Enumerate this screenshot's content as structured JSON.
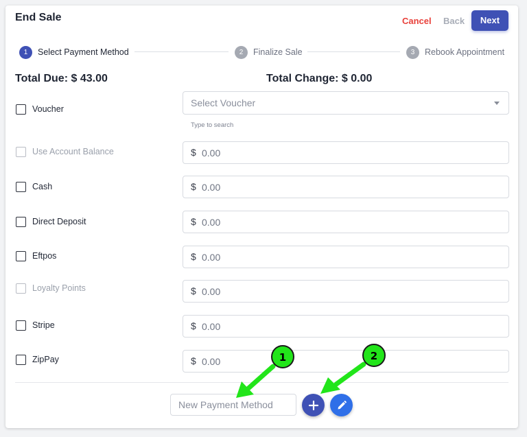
{
  "header": {
    "title": "End Sale",
    "cancel_label": "Cancel",
    "back_label": "Back",
    "next_label": "Next"
  },
  "stepper": {
    "steps": [
      {
        "number": "1",
        "label": "Select Payment Method",
        "state": "active"
      },
      {
        "number": "2",
        "label": "Finalize Sale",
        "state": "inactive"
      },
      {
        "number": "3",
        "label": "Rebook Appointment",
        "state": "inactive"
      }
    ]
  },
  "totals": {
    "total_due": "Total Due: $ 43.00",
    "total_change": "Total Change: $ 0.00"
  },
  "voucher": {
    "label": "Voucher",
    "placeholder": "Select Voucher",
    "hint": "Type to search"
  },
  "currency_symbol": "$",
  "payment_methods": [
    {
      "label": "Use Account Balance",
      "value": "0.00",
      "disabled": true
    },
    {
      "label": "Cash",
      "value": "0.00",
      "disabled": false
    },
    {
      "label": "Direct Deposit",
      "value": "0.00",
      "disabled": false
    },
    {
      "label": "Eftpos",
      "value": "0.00",
      "disabled": false
    },
    {
      "label": "Loyalty Points",
      "value": "0.00",
      "disabled": true
    },
    {
      "label": "Stripe",
      "value": "0.00",
      "disabled": false
    },
    {
      "label": "ZipPay",
      "value": "0.00",
      "disabled": false
    }
  ],
  "new_payment_method": {
    "placeholder": "New Payment Method",
    "add_icon": "plus-icon",
    "edit_icon": "pencil-icon"
  },
  "annotations": [
    {
      "number": "1",
      "color": "#22e51a"
    },
    {
      "number": "2",
      "color": "#22e51a"
    }
  ],
  "colors": {
    "primary": "#3f51b5",
    "cancel": "#e8413b",
    "edit_button": "#2f6fe8",
    "annotation": "#22e51a"
  }
}
